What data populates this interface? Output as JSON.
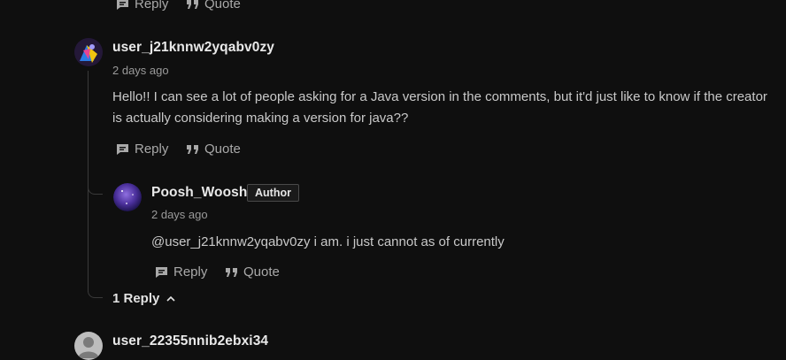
{
  "top_actions": {
    "reply": "Reply",
    "quote": "Quote"
  },
  "comment1": {
    "username": "user_j21knnw2yqabv0zy",
    "time": "2 days ago",
    "text": "Hello!! I can see a lot of people asking for a Java version in the comments, but it'd just like to know if the creator is actually considering making a version for java??",
    "reply": "Reply",
    "quote": "Quote"
  },
  "comment2": {
    "username": "Poosh_Woosh",
    "badge": "Author",
    "time": "2 days ago",
    "text": "@user_j21knnw2yqabv0zy i am. i just cannot as of currently",
    "reply": "Reply",
    "quote": "Quote"
  },
  "replies_toggle": "1 Reply",
  "comment3": {
    "username": "user_22355nnib2ebxi34"
  },
  "icons": [
    "reply-icon",
    "quote-icon",
    "chevron-up-icon",
    "avatar-placeholder-icon"
  ]
}
